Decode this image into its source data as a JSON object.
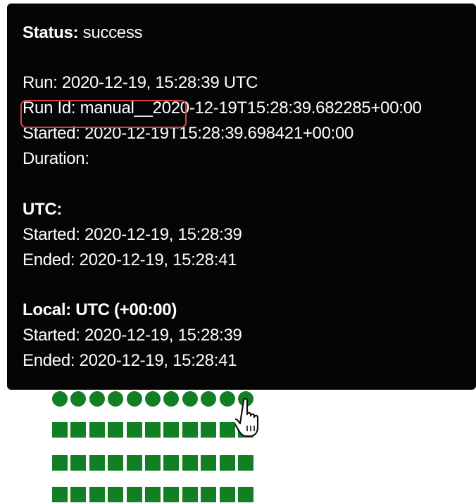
{
  "tooltip": {
    "status_label": "Status:",
    "status_value": "success",
    "run": "Run: 2020-12-19, 15:28:39 UTC",
    "run_id": "Run Id: manual__2020-12-19T15:28:39.682285+00:00",
    "started": "Started: 2020-12-19T15:28:39.698421+00:00",
    "duration": "Duration:",
    "utc_heading": "UTC:",
    "utc_started": "Started: 2020-12-19, 15:28:39",
    "utc_ended": "Ended: 2020-12-19, 15:28:41",
    "local_heading": "Local: UTC (+00:00)",
    "local_started": "Started: 2020-12-19, 15:28:39",
    "local_ended": "Ended: 2020-12-19, 15:28:41"
  },
  "grid": {
    "rows": [
      {
        "shape": "circle",
        "count": 11,
        "status": "success"
      },
      {
        "shape": "square",
        "count": 11,
        "status": "success"
      },
      {
        "shape": "square",
        "count": 11,
        "status": "success"
      },
      {
        "shape": "square",
        "count": 11,
        "status": "success"
      }
    ],
    "color": "#127f24"
  },
  "colors": {
    "tooltip_bg": "#050505",
    "highlight": "#d9453d",
    "success": "#127f24"
  },
  "cursor_icon": "hand-pointer-icon"
}
